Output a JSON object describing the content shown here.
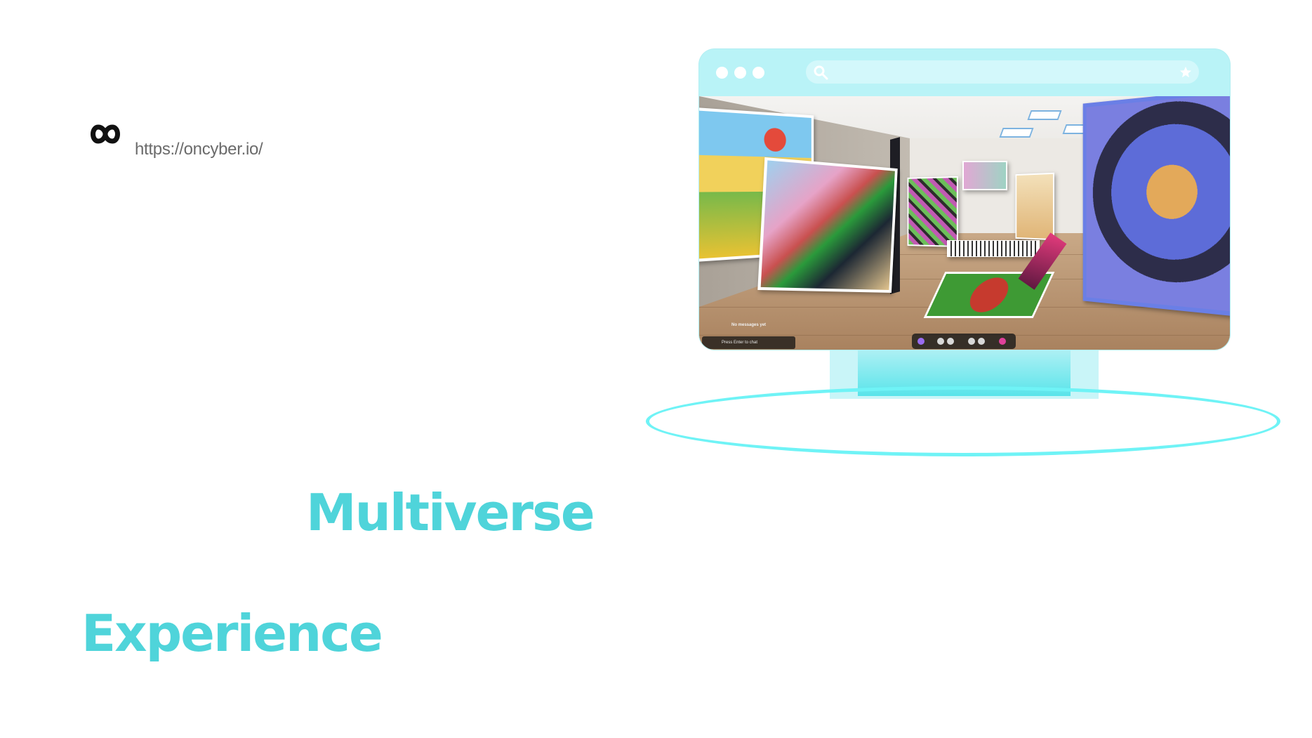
{
  "header": {
    "logo_icon": "infinity-logo-icon",
    "url": "https://oncyber.io/"
  },
  "headlines": {
    "line1": "Multiverse",
    "line2": "Experience"
  },
  "colors": {
    "accent": "#4fd4da",
    "ring": "#6ff3f6",
    "browser": "#b9f3f7",
    "url_text": "#6b6b6b"
  },
  "browser_mock": {
    "window_dots": [
      "dot",
      "dot",
      "dot"
    ],
    "search_icon": "search-icon",
    "bookmark_icon": "star-icon",
    "viewport": {
      "status_text": "No messages yet",
      "chat_placeholder": "Press Enter to chat",
      "toolbar_icons": [
        "avatar-icon",
        "chat-icon",
        "mic-icon",
        "people-icon",
        "camera-icon",
        "profile-icon"
      ]
    }
  }
}
